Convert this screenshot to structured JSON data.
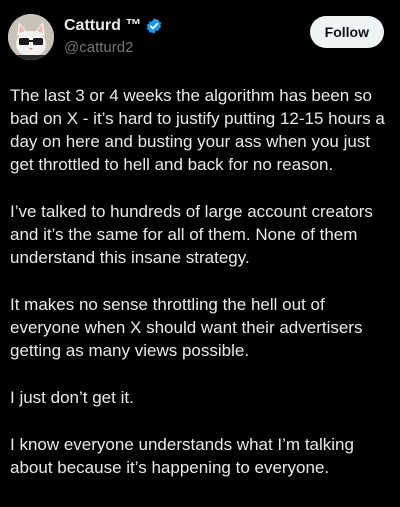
{
  "author": {
    "display_name": "Catturd ™",
    "handle": "@catturd2",
    "verified": true,
    "avatar": "cartoon-cat-with-glasses-avatar"
  },
  "follow_label": "Follow",
  "paragraphs": [
    "The last 3 or 4 weeks the algorithm has been so bad on X - it’s hard to justify putting 12-15 hours a day on here and busting your ass when you just get throttled to hell and back for no reason.",
    "I’ve talked to hundreds of large account creators and it’s the same for all of them. None of them understand this insane strategy.",
    "It makes no sense throttling the hell out of everyone when X should want their advertisers getting as many views possible.",
    "I just don’t get it.",
    "I know everyone understands what I’m talking about because it’s happening to everyone."
  ],
  "colors": {
    "background": "#000000",
    "text": "#e7e9ea",
    "handle": "#71767b",
    "verified_badge": "#1d9bf0",
    "follow_bg": "#eff3f4"
  }
}
